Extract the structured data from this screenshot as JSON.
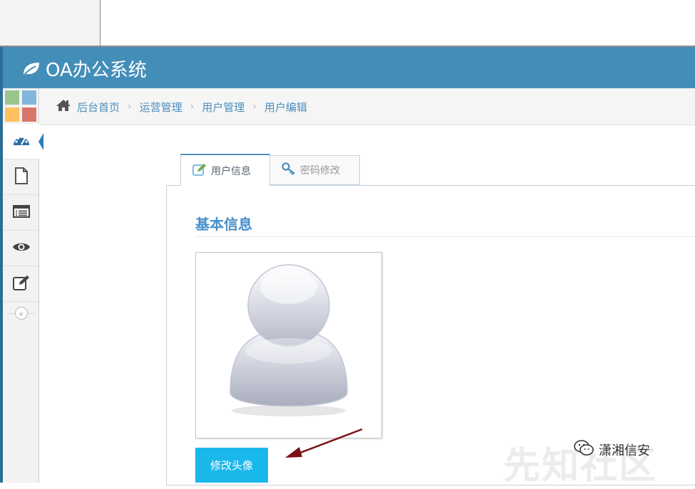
{
  "app": {
    "title": "OA办公系统"
  },
  "breadcrumb": {
    "items": [
      "后台首页",
      "运营管理",
      "用户管理",
      "用户编辑"
    ]
  },
  "sidebar": {
    "items": [
      {
        "icon": "dashboard-icon",
        "active": true
      },
      {
        "icon": "file-icon",
        "active": false
      },
      {
        "icon": "list-icon",
        "active": false
      },
      {
        "icon": "eye-icon",
        "active": false
      },
      {
        "icon": "edit-icon",
        "active": false
      }
    ],
    "collapse_label": "«"
  },
  "tabs": [
    {
      "label": "用户信息",
      "icon": "edit-icon",
      "active": true
    },
    {
      "label": "密码修改",
      "icon": "key-icon",
      "active": false
    }
  ],
  "section": {
    "title": "基本信息"
  },
  "avatar": {
    "button_label": "修改头像"
  },
  "watermark": {
    "text": "潇湘信安",
    "faint_text": "先知社区"
  },
  "colors": {
    "navbar": "#438eb9",
    "link": "#4c8fbd",
    "button": "#1ab7ea",
    "annotation_arrow": "#7b1113"
  }
}
